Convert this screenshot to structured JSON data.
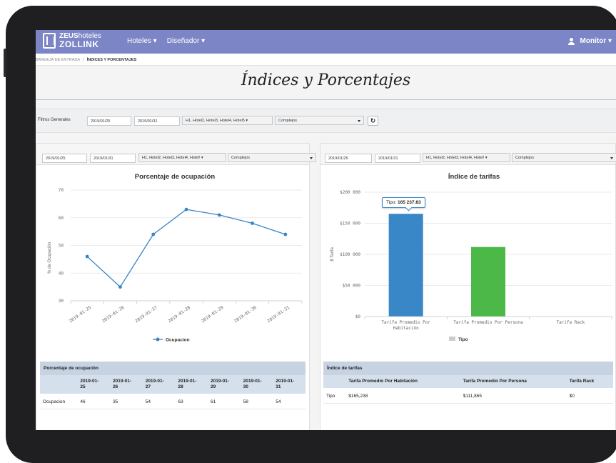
{
  "app": {
    "logo_line1_bold": "ZEUS",
    "logo_line1_light": "hoteles",
    "logo_line2": "ZOLLINK"
  },
  "nav": {
    "menu": [
      "Hoteles ▾",
      "Diseñador ▾"
    ],
    "user": "Monitor ▾"
  },
  "breadcrumb": {
    "home": "BANDEJA DE ENTRADA",
    "separator": "/",
    "current": "ÍNDICES Y PORCENTAJES"
  },
  "page_title": "Índices y Porcentajes",
  "general_filters": {
    "label": "Filtros Generales",
    "date_from": "2019/01/25",
    "date_to": "2019/01/31",
    "hotels": "H1, Hotel2, Hotel3, Hotel4, Hotel5 ▾",
    "complex": "Complejos"
  },
  "left_panel": {
    "date_from": "2019/01/25",
    "date_to": "2019/01/31",
    "hotels": "H1, Hotel2, Hotel3, Hotel4, Hotel! ▾",
    "complex": "Complejos",
    "table_title": "Porcentaje de ocupación",
    "table_headers": [
      "",
      "2019-01-\n25",
      "2019-01-\n26",
      "2019-01-\n27",
      "2019-01-\n28",
      "2019-01-\n29",
      "2019-01-\n30",
      "2019-01-\n31"
    ],
    "table_rows": [
      [
        "Ocupacion",
        "46",
        "35",
        "54",
        "63",
        "61",
        "58",
        "54"
      ]
    ]
  },
  "right_panel": {
    "date_from": "2019/01/25",
    "date_to": "2019/01/31",
    "hotels": "H1, Hotel2, Hotel3, Hotel4, Hotel! ▾",
    "complex": "Complejos",
    "tooltip_label": "Tipo:",
    "tooltip_value": "165 237.83",
    "table_title": "Índice de tarifas",
    "table_headers": [
      "",
      "Tarifa Promedio Por Habitación",
      "Tarifa Promedio Por Persona",
      "Tarifa Rack"
    ],
    "table_rows": [
      [
        "Tipo",
        "$165,238",
        "$111,865",
        "$0"
      ]
    ]
  },
  "colors": {
    "navbar": "#7c86c7",
    "line": "#3a84c4",
    "bar_habitacion": "#3a87c8",
    "bar_persona": "#4cb848",
    "legend_gray": "#cccccc"
  },
  "icons": {
    "refresh": "refresh-icon",
    "user": "user-icon",
    "logo": "hotel-logo-icon"
  },
  "chart_data": [
    {
      "type": "line",
      "title": "Porcentaje de ocupación",
      "xlabel": "",
      "ylabel": "% de Ocupación",
      "x": [
        "2019-01-25",
        "2019-01-26",
        "2019-01-27",
        "2019-01-28",
        "2019-01-29",
        "2019-01-30",
        "2019-01-31"
      ],
      "series": [
        {
          "name": "Ocupacion",
          "values": [
            46,
            35,
            54,
            63,
            61,
            58,
            54
          ]
        }
      ],
      "yticks": [
        "70",
        "60",
        "50",
        "40",
        "30"
      ],
      "ylim": [
        30,
        70
      ],
      "grid": true,
      "legend": "bottom"
    },
    {
      "type": "bar",
      "title": "Índice de tarifas",
      "xlabel": "",
      "ylabel": "$ Tarifa",
      "categories": [
        "Tarifa Promedio Por Habitación",
        "Tarifa Promedio Por Persona",
        "Tarifa Rack"
      ],
      "series": [
        {
          "name": "Tipo",
          "values": [
            165237.83,
            111865,
            0
          ]
        }
      ],
      "yticks": [
        "$200 000",
        "$150 000",
        "$100 000",
        "$50 000",
        "$0"
      ],
      "ylim": [
        0,
        200000
      ],
      "grid": true,
      "legend": "bottom"
    }
  ]
}
